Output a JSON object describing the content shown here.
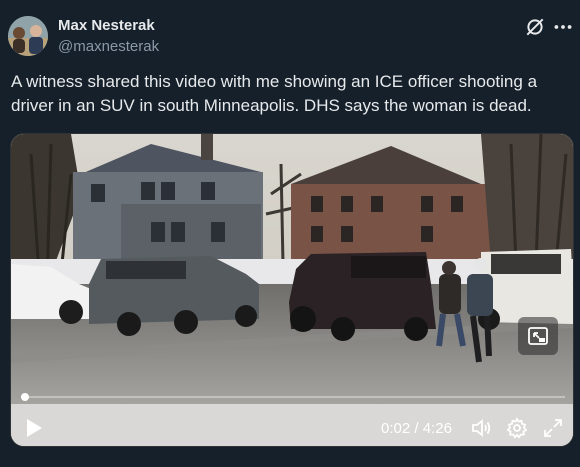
{
  "post": {
    "author_name": "Max Nesterak",
    "author_handle": "@maxnesterak",
    "text": "A witness shared this video with me showing an ICE officer shooting a driver in an SUV in south Minneapolis. DHS says the woman is dead."
  },
  "video": {
    "elapsed": "0:02",
    "separator": " / ",
    "duration": "4:26",
    "progress_fraction": 0.008
  },
  "icons": {
    "grok": "grok-icon",
    "more": "more-icon",
    "play": "play-icon",
    "volume": "volume-icon",
    "settings": "gear-icon",
    "fullscreen": "fullscreen-icon",
    "pip": "picture-in-picture-icon"
  },
  "colors": {
    "background": "#15202b",
    "text_primary": "#e7e9ea",
    "text_secondary": "#8b98a5"
  }
}
